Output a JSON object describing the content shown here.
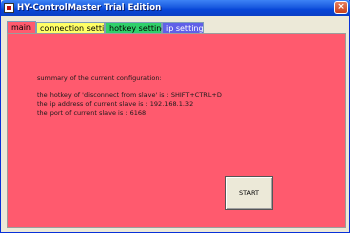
{
  "window": {
    "title": "HY-ControlMaster Trial Edition",
    "close_glyph": "×"
  },
  "tabs": [
    {
      "label": "main",
      "color": "#ff5a6e",
      "selected": true
    },
    {
      "label": "connection setting",
      "color": "#ffff66",
      "selected": false
    },
    {
      "label": "hotkey setting",
      "color": "#2fd06a",
      "selected": false
    },
    {
      "label": "ip setting",
      "color": "#6060e8",
      "selected": false
    }
  ],
  "main": {
    "summary_heading": "summary of the current configuration:",
    "hotkey_line": "the hotkey of 'disconnect from slave' is : SHIFT+CTRL+D",
    "ip_line": "the ip address of current slave is : 192.168.1.32",
    "port_line": "the port of current slave is : 6168",
    "start_label": "START"
  },
  "colors": {
    "titlebar": "#0846d8",
    "panel_background": "#ff5a6e"
  }
}
